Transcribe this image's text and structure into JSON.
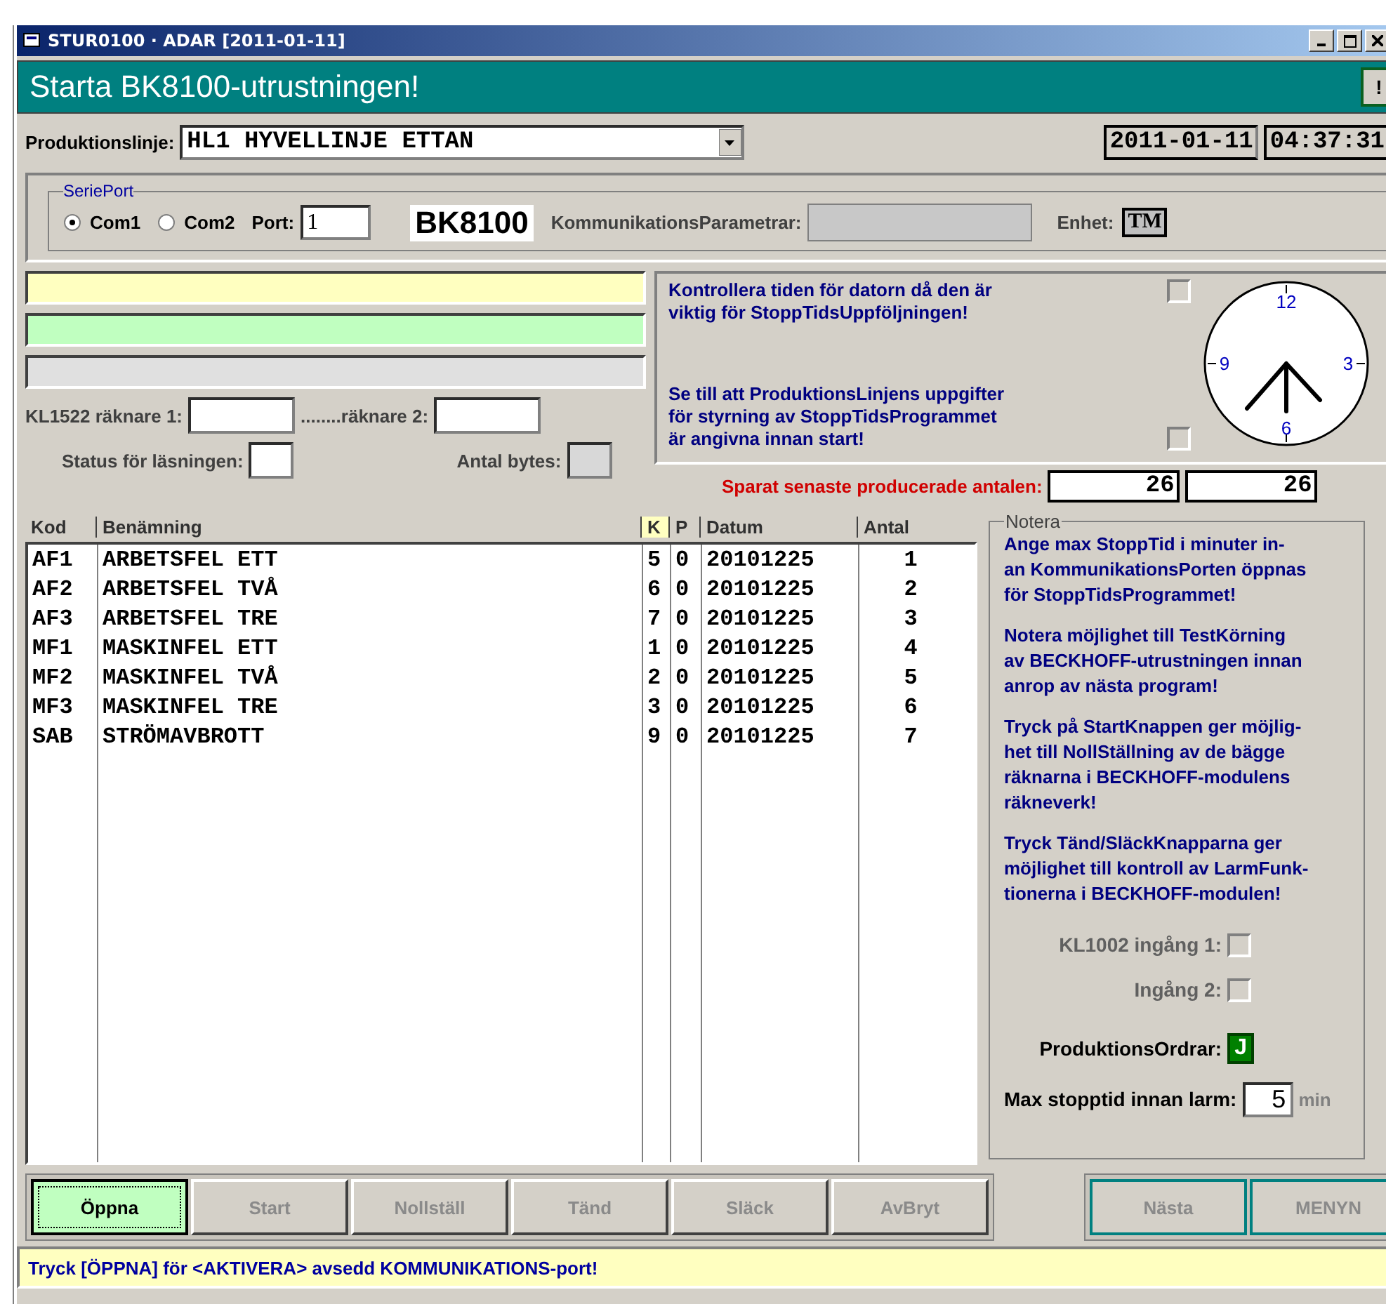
{
  "window": {
    "title": "STUR0100 · ADAR [2011-01-11]"
  },
  "header": {
    "title": "Starta BK8100-utrustningen!",
    "button": "!"
  },
  "production_line": {
    "label": "Produktionslinje:",
    "value": "HL1 HYVELLINJE ETTAN",
    "date": "2011-01-11",
    "time": "04:37:31"
  },
  "serial_port": {
    "legend": "SeriePort",
    "radios": [
      {
        "label": "Com1",
        "selected": true
      },
      {
        "label": "Com2",
        "selected": false
      }
    ],
    "port_label": "Port:",
    "port_value": "1",
    "device": "BK8100",
    "params_label": "KommunikationsParametrar:",
    "unit_label": "Enhet:",
    "unit_value": "TM"
  },
  "message_bars": [
    {
      "color": "#ffffc0"
    },
    {
      "color": "#c0ffc0"
    },
    {
      "color": "#e0e0e0"
    }
  ],
  "counters": {
    "label1": "KL1522 räknare 1:",
    "label2": "........räknare 2:",
    "status_label": "Status för läsningen:",
    "bytes_label": "Antal bytes:"
  },
  "checks": [
    {
      "text": "Kontrollera tiden för datorn då den är\nviktig för StoppTidsUppföljningen!",
      "checked": false
    },
    {
      "text": "Se till att ProduktionsLinjens uppgifter\nför styrning av StoppTidsProgrammet\när angivna innan start!",
      "checked": false
    }
  ],
  "clock": {
    "numerals": [
      "12",
      "3",
      "6",
      "9"
    ]
  },
  "saved": {
    "label": "Sparat senaste producerade antalen:",
    "values": [
      "26",
      "26"
    ]
  },
  "table": {
    "columns": [
      {
        "label": "Kod",
        "selected": false
      },
      {
        "label": "Benämning",
        "selected": false
      },
      {
        "label": "K",
        "selected": true
      },
      {
        "label": "P",
        "selected": false
      },
      {
        "label": "Datum",
        "selected": false
      },
      {
        "label": "Antal",
        "selected": false
      }
    ],
    "rows": [
      [
        "AF1",
        "ARBETSFEL ETT",
        "5",
        "0",
        "20101225",
        "1"
      ],
      [
        "AF2",
        "ARBETSFEL TVÅ",
        "6",
        "0",
        "20101225",
        "2"
      ],
      [
        "AF3",
        "ARBETSFEL TRE",
        "7",
        "0",
        "20101225",
        "3"
      ],
      [
        "MF1",
        "MASKINFEL ETT",
        "1",
        "0",
        "20101225",
        "4"
      ],
      [
        "MF2",
        "MASKINFEL TVÅ",
        "2",
        "0",
        "20101225",
        "5"
      ],
      [
        "MF3",
        "MASKINFEL TRE",
        "3",
        "0",
        "20101225",
        "6"
      ],
      [
        "SAB",
        "STRÖMAVBROTT",
        "9",
        "0",
        "20101225",
        "7"
      ]
    ]
  },
  "notes": {
    "legend": "Notera",
    "paragraphs": [
      "Ange max StoppTid i minuter in-\nan KommunikationsPorten öppnas\nför StoppTidsProgrammet!",
      "Notera möjlighet till TestKörning\nav BECKHOFF-utrustningen innan\nanrop av nästa program!",
      "Tryck på StartKnappen ger möjlig-\nhet till NollStällning av de bägge\nräknarna i BECKHOFF-modulens\nräkneverk!",
      "Tryck Tänd/SläckKnapparna ger\nmöjlighet till kontroll av LarmFunk-\ntionerna i BECKHOFF-modulen!"
    ],
    "inputs": [
      {
        "label": "KL1002 ingång 1:",
        "checked": false,
        "disabled": true
      },
      {
        "label": "Ingång 2:",
        "checked": false,
        "disabled": true
      }
    ],
    "orders": {
      "label": "ProduktionsOrdrar:",
      "value": "J"
    },
    "max_stop": {
      "label": "Max stopptid innan larm:",
      "value": "5",
      "unit": "min"
    }
  },
  "buttons_left": [
    {
      "label": "Öppna",
      "disabled": false
    },
    {
      "label": "Start",
      "disabled": true
    },
    {
      "label": "Nollställ",
      "disabled": true
    },
    {
      "label": "Tänd",
      "disabled": true
    },
    {
      "label": "Släck",
      "disabled": true
    },
    {
      "label": "AvBryt",
      "disabled": true
    }
  ],
  "buttons_right": [
    {
      "label": "Nästa",
      "disabled": true
    },
    {
      "label": "MENYN",
      "disabled": true
    }
  ],
  "status_bar": "Tryck [ÖPPNA] för <AKTIVERA> avsedd KOMMUNIKATIONS-port!"
}
